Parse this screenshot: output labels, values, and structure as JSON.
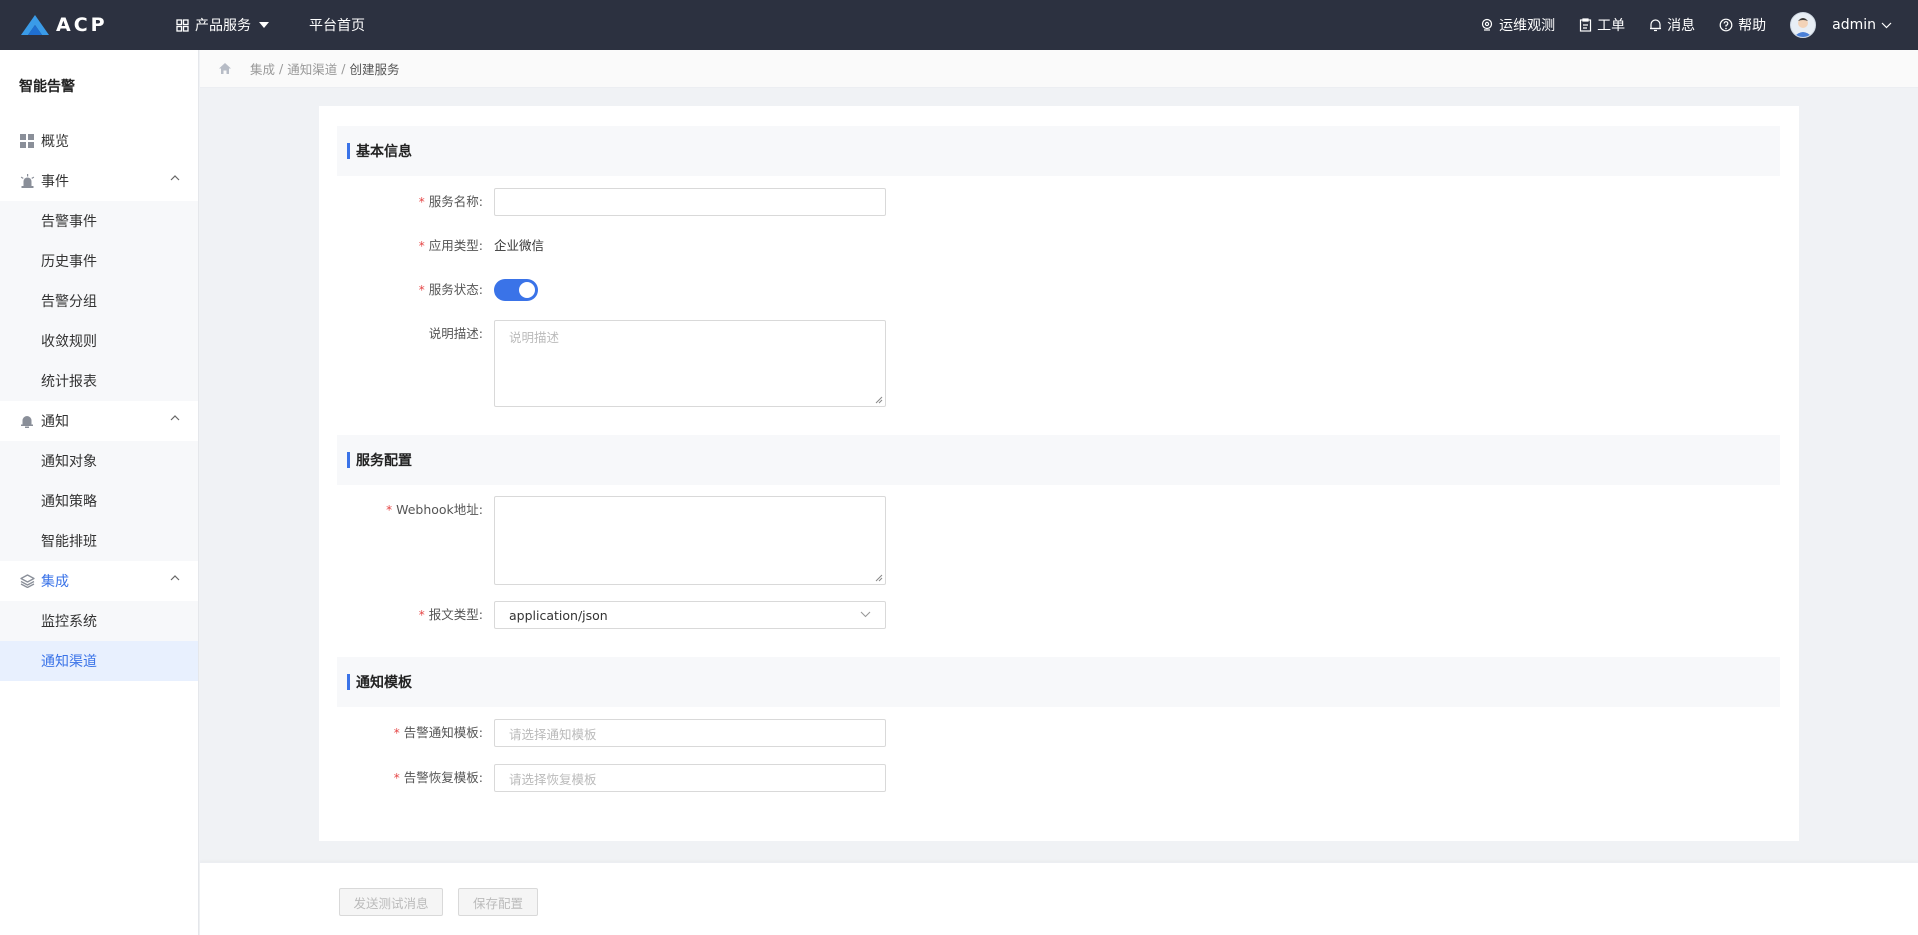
{
  "topbar": {
    "logo_text": "ACP",
    "nav": [
      {
        "label": "产品服务"
      },
      {
        "label": "平台首页"
      }
    ],
    "right": [
      {
        "label": "运维观测",
        "icon": "location-pin-icon"
      },
      {
        "label": "工单",
        "icon": "clipboard-icon"
      },
      {
        "label": "消息",
        "icon": "bell-icon"
      },
      {
        "label": "帮助",
        "icon": "help-circle-icon"
      }
    ],
    "user": "admin"
  },
  "sidebar": {
    "title": "智能告警",
    "overview": "概览",
    "groups": [
      {
        "label": "事件",
        "icon": "alarm-light-icon",
        "items": [
          "告警事件",
          "历史事件",
          "告警分组",
          "收敛规则",
          "统计报表"
        ]
      },
      {
        "label": "通知",
        "icon": "bell-icon",
        "items": [
          "通知对象",
          "通知策略",
          "智能排班"
        ]
      },
      {
        "label": "集成",
        "icon": "layers-icon",
        "items": [
          "监控系统",
          "通知渠道"
        ]
      }
    ],
    "active_item": "通知渠道"
  },
  "breadcrumb": {
    "items": [
      "集成",
      "通知渠道"
    ],
    "separator": "/",
    "current": "创建服务"
  },
  "sections": {
    "basic": "基本信息",
    "service_config": "服务配置",
    "template": "通知模板"
  },
  "form": {
    "service_name": {
      "label": "服务名称:",
      "value": ""
    },
    "app_type": {
      "label": "应用类型:",
      "value": "企业微信"
    },
    "service_status": {
      "label": "服务状态:",
      "on": true
    },
    "description": {
      "label": "说明描述:",
      "placeholder": "说明描述"
    },
    "webhook": {
      "label": "Webhook地址:",
      "value": ""
    },
    "payload_type": {
      "label": "报文类型:",
      "value": "application/json"
    },
    "alert_template": {
      "label": "告警通知模板:",
      "placeholder": "请选择通知模板"
    },
    "recovery_template": {
      "label": "告警恢复模板:",
      "placeholder": "请选择恢复模板"
    },
    "required_mark": "*"
  },
  "footer": {
    "send_test": "发送测试消息",
    "save": "保存配置"
  },
  "colors": {
    "topbar": "#2c3140",
    "accent": "#3a73e8",
    "required": "#e54545"
  }
}
